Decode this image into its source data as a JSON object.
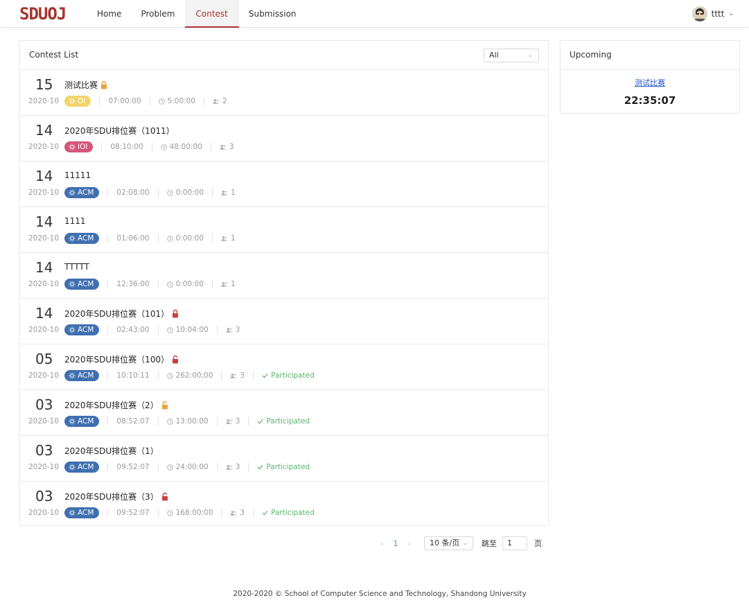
{
  "header": {
    "logo_text": "SDUOJ",
    "nav": [
      "Home",
      "Problem",
      "Contest",
      "Submission"
    ],
    "active_nav": "Contest",
    "username": "tttt"
  },
  "contest_list": {
    "title": "Contest List",
    "filter_value": "All",
    "rows": [
      {
        "day": "15",
        "ym": "2020-10",
        "name": "测试比赛",
        "lock": "orange",
        "mode": "OI",
        "start": "07:00:00",
        "duration": "5:00:00",
        "participants": "2",
        "participated": ""
      },
      {
        "day": "14",
        "ym": "2020-10",
        "name": "2020年SDU排位赛（1011）",
        "lock": "",
        "mode": "IOI",
        "start": "08:10:00",
        "duration": "48:00:00",
        "participants": "3",
        "participated": ""
      },
      {
        "day": "14",
        "ym": "2020-10",
        "name": "11111",
        "lock": "",
        "mode": "ACM",
        "start": "02:08:00",
        "duration": "0:00:00",
        "participants": "1",
        "participated": ""
      },
      {
        "day": "14",
        "ym": "2020-10",
        "name": "1111",
        "lock": "",
        "mode": "ACM",
        "start": "01:06:00",
        "duration": "0:00:00",
        "participants": "1",
        "participated": ""
      },
      {
        "day": "14",
        "ym": "2020-10",
        "name": "TTTTT",
        "lock": "",
        "mode": "ACM",
        "start": "12:36:00",
        "duration": "0:00:00",
        "participants": "1",
        "participated": ""
      },
      {
        "day": "14",
        "ym": "2020-10",
        "name": "2020年SDU排位赛（101）",
        "lock": "red",
        "mode": "ACM",
        "start": "02:43:00",
        "duration": "10:04:00",
        "participants": "3",
        "participated": ""
      },
      {
        "day": "05",
        "ym": "2020-10",
        "name": "2020年SDU排位赛（100）",
        "lock": "red-open",
        "mode": "ACM",
        "start": "10:10:11",
        "duration": "262:00:00",
        "participants": "3",
        "participated": "Participated"
      },
      {
        "day": "03",
        "ym": "2020-10",
        "name": "2020年SDU排位赛（2）",
        "lock": "orange-open",
        "mode": "ACM",
        "start": "08:52:07",
        "duration": "13:00:00",
        "participants": "3",
        "participated": "Participated"
      },
      {
        "day": "03",
        "ym": "2020-10",
        "name": "2020年SDU排位赛（1）",
        "lock": "",
        "mode": "ACM",
        "start": "09:52:07",
        "duration": "24:00:00",
        "participants": "3",
        "participated": "Participated"
      },
      {
        "day": "03",
        "ym": "2020-10",
        "name": "2020年SDU排位赛（3）",
        "lock": "red-open",
        "mode": "ACM",
        "start": "09:52:07",
        "duration": "168:00:00",
        "participants": "3",
        "participated": "Participated"
      }
    ]
  },
  "pager": {
    "current_page": "1",
    "page_size": "10 条/页",
    "jump_label": "跳至",
    "jump_value": "1",
    "page_suffix": "页"
  },
  "upcoming": {
    "title": "Upcoming",
    "contest_name": "测试比赛",
    "countdown": "22:35:07"
  },
  "footer": {
    "text": "2020-2020 © School of Computer Science and Technology, Shandong University"
  },
  "colors": {
    "brand": "#a5342f",
    "oi": "#f2d56a",
    "ioi": "#d6557a",
    "acm": "#3f6fb0",
    "participated": "#5bb36c"
  }
}
